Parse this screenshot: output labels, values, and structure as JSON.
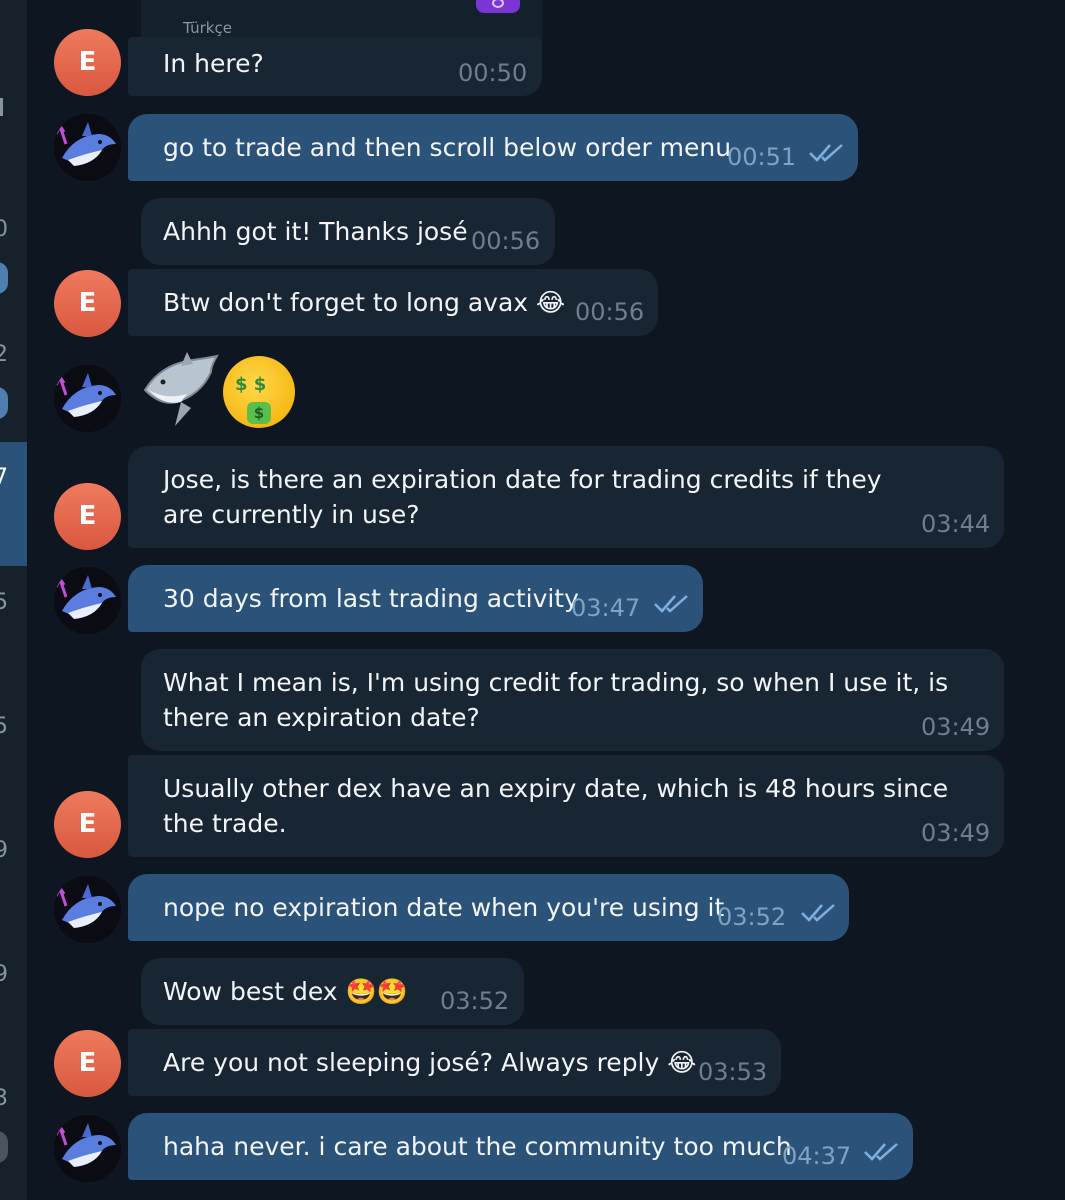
{
  "preview": {
    "language_label": "Türkçe"
  },
  "sidebar": {
    "numbers": [
      "0",
      "2",
      "7",
      "5",
      "5",
      "9",
      "9",
      "3"
    ]
  },
  "contacts": {
    "e_initial": "E"
  },
  "messages": [
    {
      "text": "In here?",
      "time": "00:50"
    },
    {
      "text": "go to trade and then scroll below order menu",
      "time": "00:51"
    },
    {
      "text": "Ahhh got it! Thanks josé",
      "time": "00:56"
    },
    {
      "text": "Btw don't forget to long avax",
      "time": "00:56",
      "emoji": "😂"
    },
    {
      "text": "",
      "emoji": "🦈🤑"
    },
    {
      "text": "Jose, is there an expiration date for trading credits if they are currently in use?",
      "time": "03:44"
    },
    {
      "text": "30 days from last trading activity",
      "time": "03:47"
    },
    {
      "text": "What I mean is, I'm using credit for trading, so when I use it, is there an expiration date?",
      "time": "03:49"
    },
    {
      "text": "Usually other dex have an expiry date, which is 48 hours since the trade.",
      "time": "03:49"
    },
    {
      "text": "nope no expiration date when you're using it",
      "time": "03:52"
    },
    {
      "text": "Wow best dex",
      "time": "03:52",
      "emoji": "🤩🤩"
    },
    {
      "text": "Are you not sleeping josé? Always reply",
      "time": "03:53",
      "emoji": "😂"
    },
    {
      "text": "haha never. i care about the community too much",
      "time": "04:37"
    }
  ],
  "colors": {
    "background": "#0e1621",
    "incoming_bubble": "#182533",
    "outgoing_bubble": "#2b5278",
    "avatar_e": "#e06a4f",
    "read_check": "#7fb0e0"
  }
}
